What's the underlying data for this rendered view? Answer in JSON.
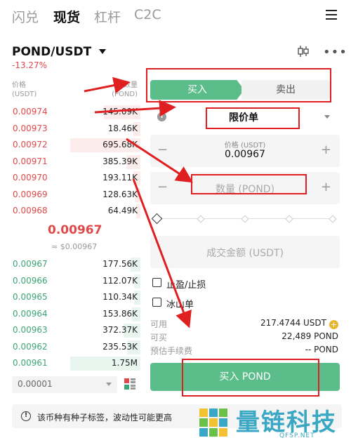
{
  "nav": {
    "tabs": [
      "闪兑",
      "现货",
      "杠杆",
      "C2C"
    ],
    "active": 1
  },
  "pair": {
    "symbol": "POND/USDT",
    "change": "-13.27%"
  },
  "orderbook": {
    "price_header": "价格\n(USDT)",
    "qty_header": "数量\n(POND)",
    "asks": [
      {
        "price": "0.00974",
        "qty": "145.09K",
        "depth": 0.52
      },
      {
        "price": "0.00973",
        "qty": "18.46K",
        "depth": 0.1
      },
      {
        "price": "0.00972",
        "qty": "695.68K",
        "depth": 1.0
      },
      {
        "price": "0.00971",
        "qty": "385.39K",
        "depth": 0.2
      },
      {
        "price": "0.00970",
        "qty": "193.11K",
        "depth": 0.1
      },
      {
        "price": "0.00969",
        "qty": "128.63K",
        "depth": 0.08
      },
      {
        "price": "0.00968",
        "qty": "64.49K",
        "depth": 0.05
      }
    ],
    "last_price": "0.00967",
    "last_usd": "≈ $0.00967",
    "bids": [
      {
        "price": "0.00967",
        "qty": "177.56K",
        "depth": 0.14
      },
      {
        "price": "0.00966",
        "qty": "112.07K",
        "depth": 0.09
      },
      {
        "price": "0.00965",
        "qty": "110.34K",
        "depth": 0.09
      },
      {
        "price": "0.00964",
        "qty": "153.86K",
        "depth": 0.12
      },
      {
        "price": "0.00963",
        "qty": "372.37K",
        "depth": 0.24
      },
      {
        "price": "0.00962",
        "qty": "235.53K",
        "depth": 0.19
      },
      {
        "price": "0.00961",
        "qty": "1.75M",
        "depth": 1.0
      }
    ],
    "precision": "0.00001"
  },
  "form": {
    "buy_tab": "买入",
    "sell_tab": "卖出",
    "order_type": "限价单",
    "price_caption": "价格 (USDT)",
    "price_value": "0.00967",
    "qty_placeholder": "数量 (POND)",
    "total_placeholder": "成交金额 (USDT)",
    "tp_sl": "止盈/止损",
    "iceberg": "冰山单",
    "available_label": "可用",
    "available_value": "217.4744 USDT",
    "can_buy_label": "可买",
    "can_buy_value": "22,489 POND",
    "fee_label": "预估手续费",
    "fee_value": "-- POND",
    "buy_button": "买入 POND"
  },
  "notice": "该币种有种子标签，波动性可能更高",
  "watermark": {
    "name": "量链科技",
    "site": "QFSP.NET"
  },
  "colors": {
    "up": "#3ba577",
    "down": "#e0494a",
    "accent": "#5bbd8a",
    "annotation": "#e02020"
  }
}
